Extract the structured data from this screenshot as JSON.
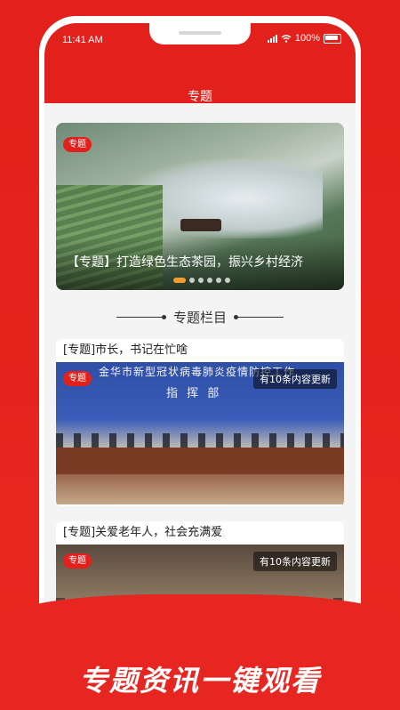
{
  "status_bar": {
    "time": "11:41 AM",
    "battery": "100%"
  },
  "header": {
    "title": "专题"
  },
  "banner": {
    "tag": "专题",
    "caption": "【专题】打造绿色生态茶园，振兴乡村经济",
    "dots_count": 6,
    "active_dot": 0
  },
  "section": {
    "title": "专题栏目"
  },
  "cards": [
    {
      "title": "[专题]市长，书记在忙啥",
      "tag": "专题",
      "update_text": "有10条内容更新",
      "image_text_line1": "金华市新型冠状病毒肺炎疫情防控工作",
      "image_text_line2": "指 挥 部"
    },
    {
      "title": "[专题]关爱老年人，社会充满爱",
      "tag": "专题",
      "update_text": "有10条内容更新"
    }
  ],
  "slogan": "专题资讯一键观看",
  "colors": {
    "brand_red": "#E3211C",
    "dot_active": "#F29B2E"
  }
}
